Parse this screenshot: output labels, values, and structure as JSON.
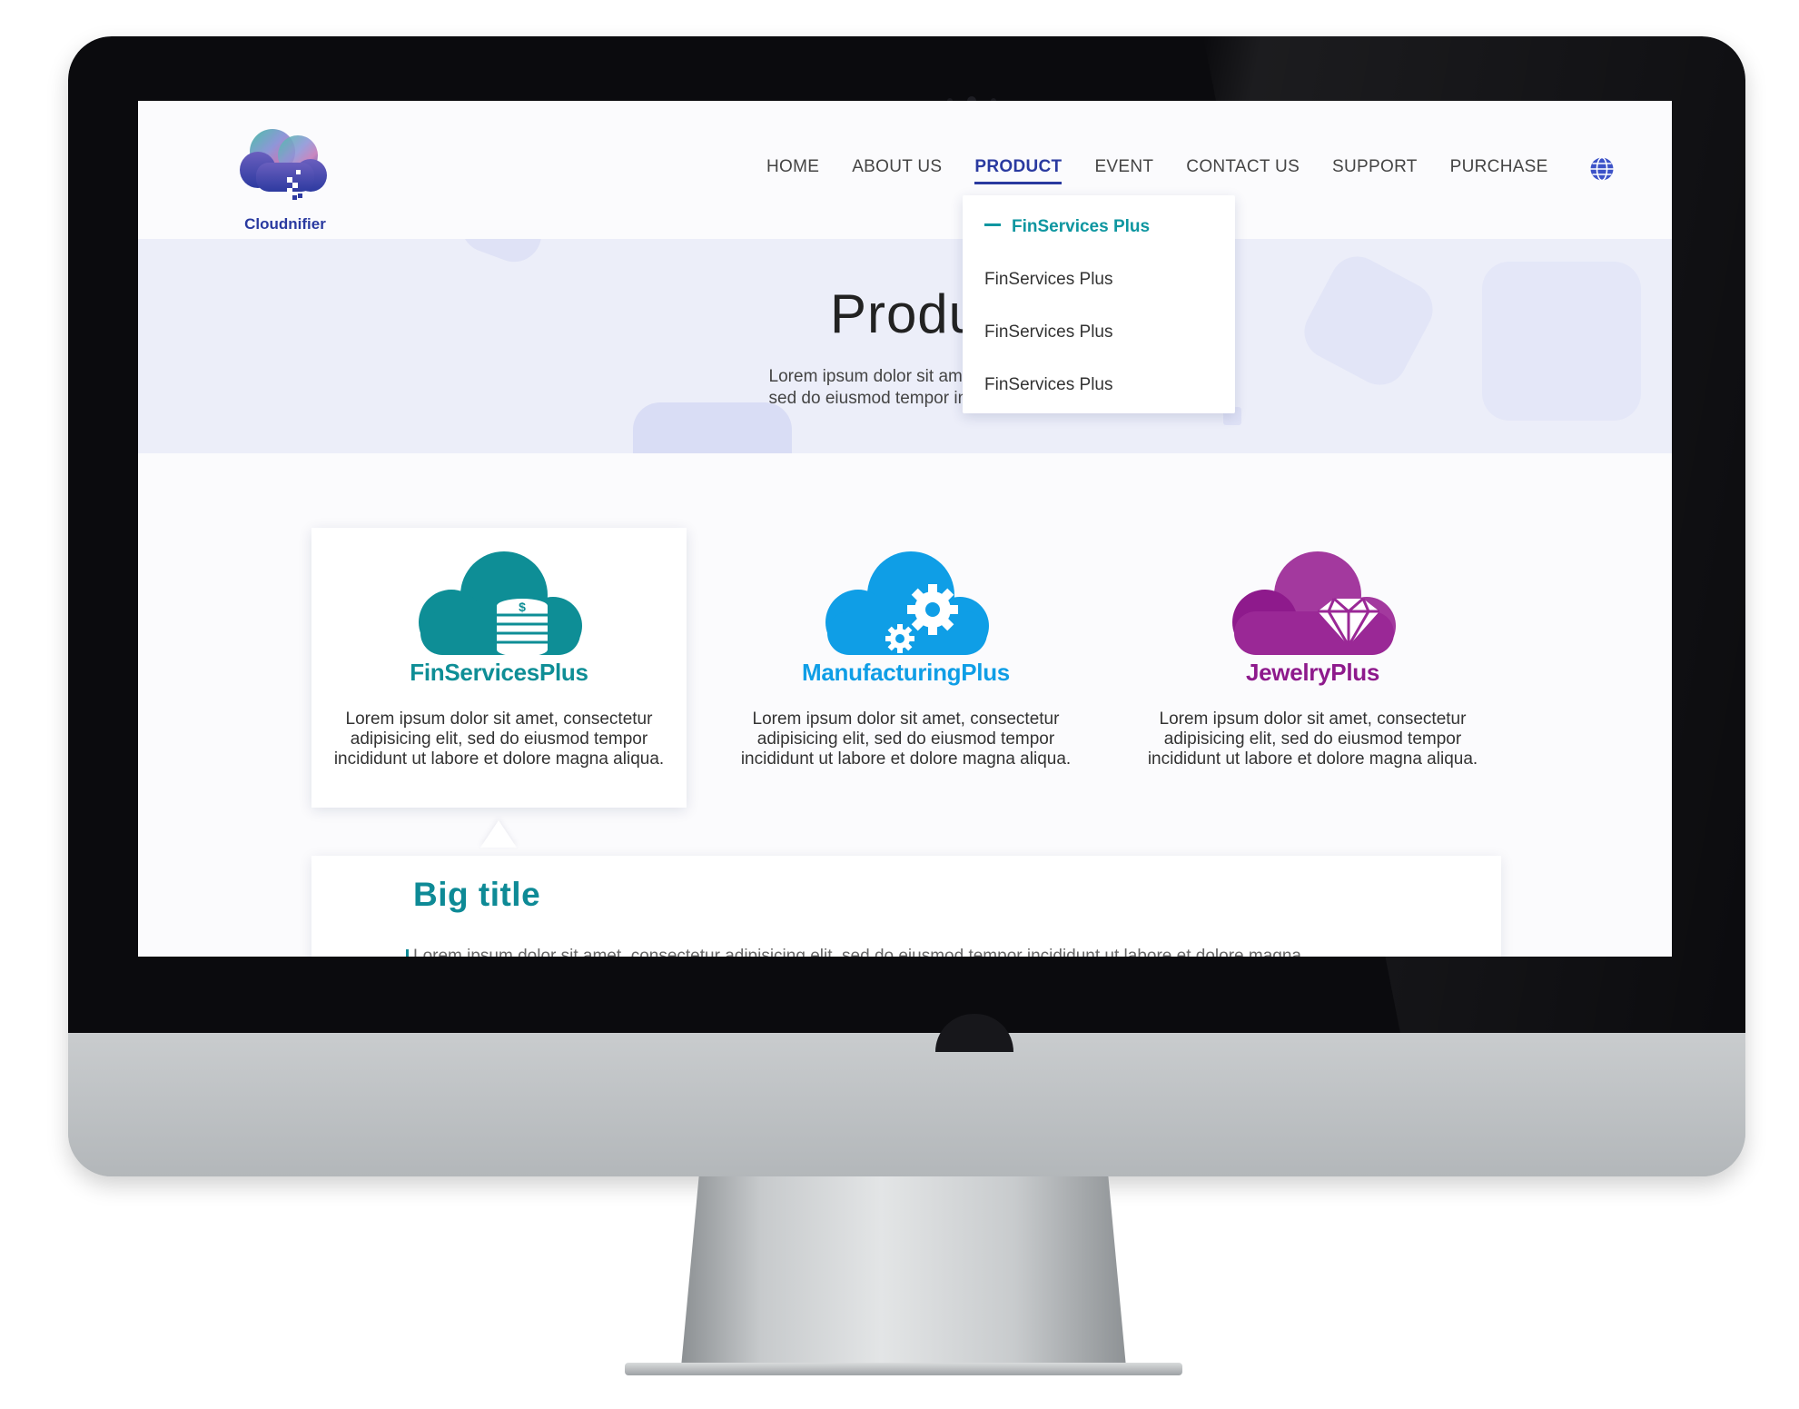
{
  "brand": {
    "name": "Cloudnifier"
  },
  "nav": {
    "items": [
      "HOME",
      "ABOUT US",
      "PRODUCT",
      "EVENT",
      "CONTACT US",
      "SUPPORT",
      "PURCHASE"
    ],
    "active_index": 2
  },
  "dropdown": {
    "items": [
      "FinServices Plus",
      "FinServices Plus",
      "FinServices Plus",
      "FinServices Plus"
    ],
    "active_index": 0
  },
  "hero": {
    "title": "Produ",
    "subtitle_line1": "Lorem ipsum dolor sit amet, consec",
    "subtitle_line2": "sed do eiusmod tempor incididunt u"
  },
  "cards": [
    {
      "title": "FinServicesPlus",
      "text": "Lorem ipsum dolor sit amet, consectetur adipisicing elit, sed do eiusmod tempor incididunt ut labore et dolore magna aliqua.",
      "color": "#0e8e96",
      "icon": "coins-icon"
    },
    {
      "title": "ManufacturingPlus",
      "text": "Lorem ipsum dolor sit amet, consectetur adipisicing elit, sed do eiusmod tempor incididunt ut labore et dolore magna aliqua.",
      "color": "#0f9ee6",
      "icon": "gears-icon"
    },
    {
      "title": "JewelryPlus",
      "text": "Lorem ipsum dolor sit amet, consectetur adipisicing elit, sed do eiusmod tempor incididunt ut labore et dolore magna aliqua.",
      "color": "#8e1a8c",
      "icon": "diamond-icon"
    }
  ],
  "detail": {
    "title": "Big title",
    "line": "Lorem ipsum dolor sit amet, consectetur adipisicing elit, sed do eiusmod tempor incididunt ut labore et dolore magna"
  },
  "colors": {
    "brand": "#2a3aa0",
    "accent": "#0e96a0",
    "hero_bg": "#eceef9"
  }
}
